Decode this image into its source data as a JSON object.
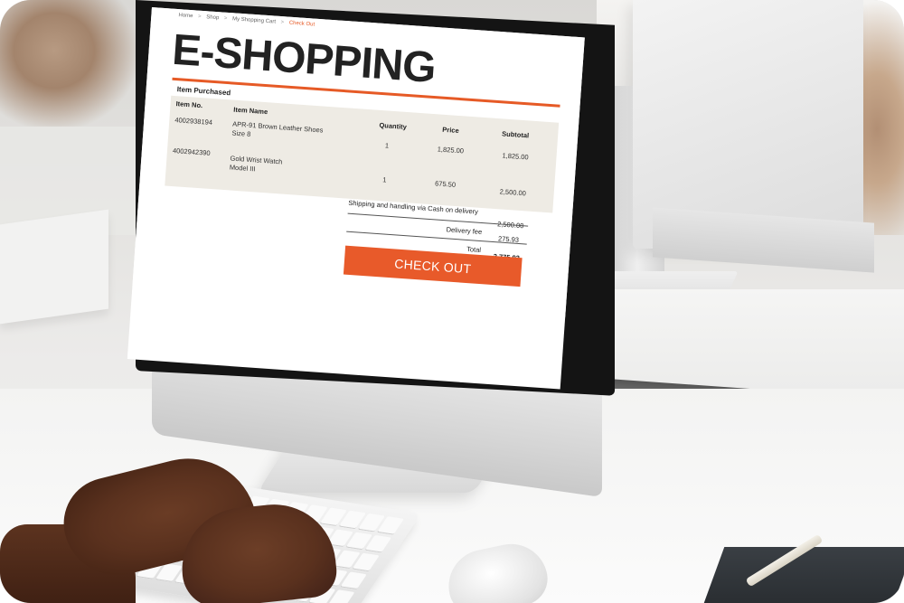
{
  "scene": {
    "description_icons": [
      "monitor",
      "keyboard",
      "mouse",
      "hands",
      "notebook",
      "pen"
    ]
  },
  "screen": {
    "breadcrumb": [
      "Home",
      "Shop",
      "My Shopping Cart",
      "Check Out"
    ],
    "breadcrumb_separator": ">",
    "title": "E-SHOPPING",
    "section_label": "Item Purchased",
    "columns": [
      "Item No.",
      "Item Name",
      "Quantity",
      "Price",
      "Subtotal"
    ],
    "rows": [
      {
        "item_no": "4002938194",
        "item_name_line1": "APR-91 Brown Leather Shoes",
        "item_name_line2": "Size 8",
        "quantity": "1",
        "price": "1,825.00",
        "subtotal": "1,825.00"
      },
      {
        "item_no": "4002942390",
        "item_name_line1": "Gold Wrist Watch",
        "item_name_line2": "Model III",
        "quantity": "1",
        "price": "675.50",
        "subtotal": "2,500.00"
      }
    ],
    "shipping_label": "Shipping and handling via Cash on delivery",
    "shipping_value": "2,500.00",
    "delivery_label": "Delivery fee",
    "delivery_value": "275.93",
    "total_label": "Total",
    "total_value": "2,775.93",
    "checkout_label": "CHECK OUT"
  },
  "colors": {
    "accent": "#e65a26",
    "table_bg": "#eeebe4"
  }
}
